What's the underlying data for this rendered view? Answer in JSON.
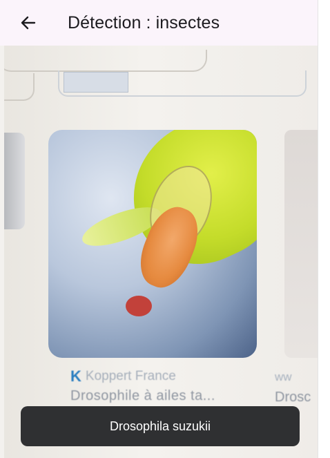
{
  "appbar": {
    "title": "Détection : insectes",
    "back_icon": "arrow-left-icon"
  },
  "result_card": {
    "source": "Koppert France",
    "caption": "Drosophile à ailes ta...",
    "source_icon": "koppert-k-icon"
  },
  "next_card": {
    "source": "ww",
    "caption": "Drosc"
  },
  "snackbar": {
    "text": "Drosophila suzukii"
  },
  "colors": {
    "appbar_bg": "#fbf4fb",
    "snackbar_bg": "#2f3032",
    "title_text": "#1c1b1f"
  }
}
